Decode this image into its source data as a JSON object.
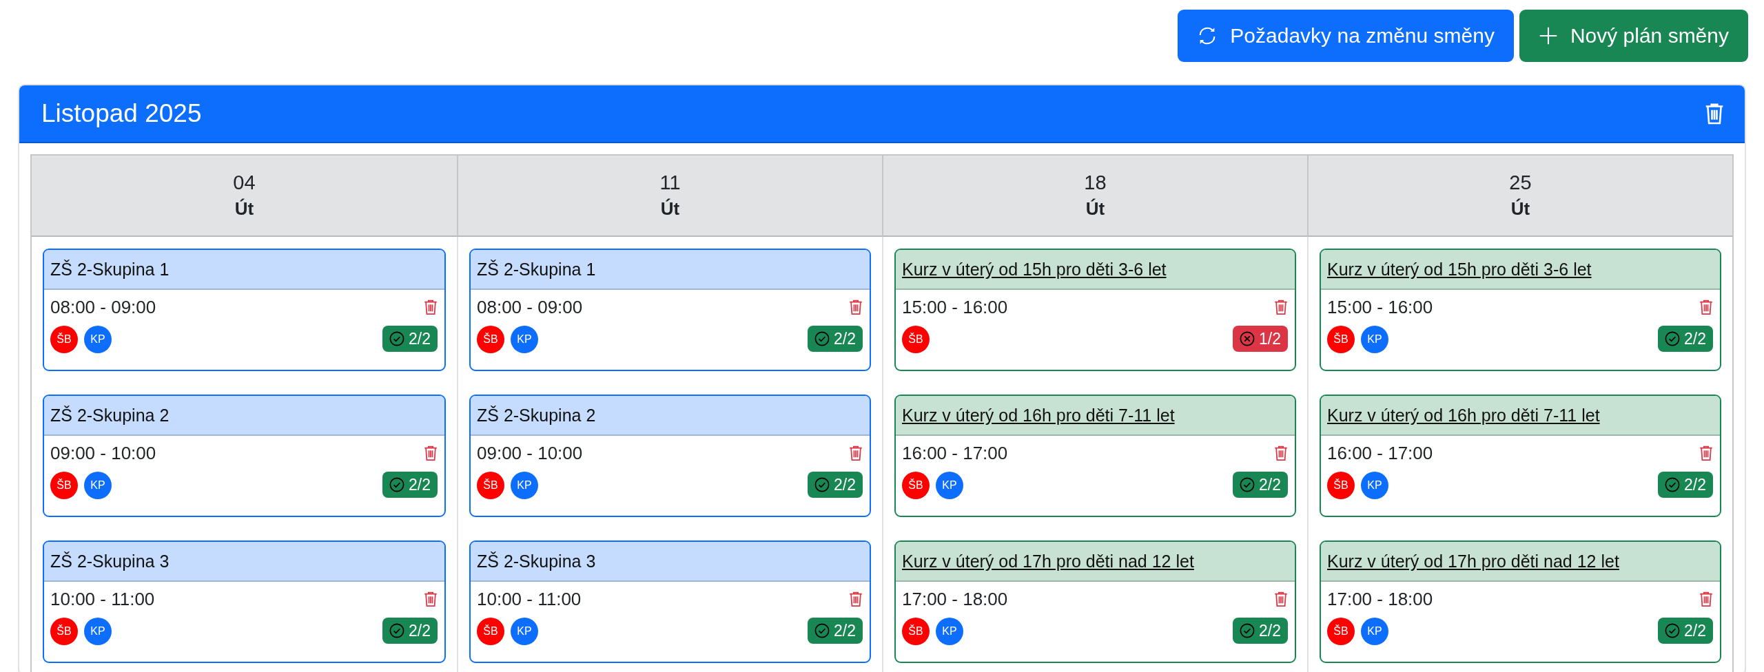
{
  "toolbar": {
    "buttons": [
      {
        "label": "Požadavky na změnu směny",
        "kind": "requests"
      },
      {
        "label": "Nový plán směny",
        "kind": "new"
      }
    ]
  },
  "panel": {
    "title": "Listopad 2025",
    "days": [
      {
        "date": "04",
        "weekday": "Út",
        "shifts": [
          {
            "kind": "group",
            "title": "ZŠ 2-Skupina 1",
            "time": "08:00 - 09:00",
            "people": [
              {
                "initials": "ŠB",
                "color": "#ff0000"
              },
              {
                "initials": "KP",
                "color": "#0d6efd"
              }
            ],
            "filled": true,
            "count": "2/2"
          },
          {
            "kind": "group",
            "title": "ZŠ 2-Skupina 2",
            "time": "09:00 - 10:00",
            "people": [
              {
                "initials": "ŠB",
                "color": "#ff0000"
              },
              {
                "initials": "KP",
                "color": "#0d6efd"
              }
            ],
            "filled": true,
            "count": "2/2"
          },
          {
            "kind": "group",
            "title": "ZŠ 2-Skupina 3",
            "time": "10:00 - 11:00",
            "people": [
              {
                "initials": "ŠB",
                "color": "#ff0000"
              },
              {
                "initials": "KP",
                "color": "#0d6efd"
              }
            ],
            "filled": true,
            "count": "2/2"
          }
        ]
      },
      {
        "date": "11",
        "weekday": "Út",
        "shifts": [
          {
            "kind": "group",
            "title": "ZŠ 2-Skupina 1",
            "time": "08:00 - 09:00",
            "people": [
              {
                "initials": "ŠB",
                "color": "#ff0000"
              },
              {
                "initials": "KP",
                "color": "#0d6efd"
              }
            ],
            "filled": true,
            "count": "2/2"
          },
          {
            "kind": "group",
            "title": "ZŠ 2-Skupina 2",
            "time": "09:00 - 10:00",
            "people": [
              {
                "initials": "ŠB",
                "color": "#ff0000"
              },
              {
                "initials": "KP",
                "color": "#0d6efd"
              }
            ],
            "filled": true,
            "count": "2/2"
          },
          {
            "kind": "group",
            "title": "ZŠ 2-Skupina 3",
            "time": "10:00 - 11:00",
            "people": [
              {
                "initials": "ŠB",
                "color": "#ff0000"
              },
              {
                "initials": "KP",
                "color": "#0d6efd"
              }
            ],
            "filled": true,
            "count": "2/2"
          }
        ]
      },
      {
        "date": "18",
        "weekday": "Út",
        "shifts": [
          {
            "kind": "course",
            "title": "Kurz v úterý od 15h pro děti 3-6 let",
            "time": "15:00 - 16:00",
            "people": [
              {
                "initials": "ŠB",
                "color": "#ff0000"
              }
            ],
            "filled": false,
            "count": "1/2"
          },
          {
            "kind": "course",
            "title": "Kurz v úterý od 16h pro děti 7-11 let",
            "time": "16:00 - 17:00",
            "people": [
              {
                "initials": "ŠB",
                "color": "#ff0000"
              },
              {
                "initials": "KP",
                "color": "#0d6efd"
              }
            ],
            "filled": true,
            "count": "2/2"
          },
          {
            "kind": "course",
            "title": "Kurz v úterý od 17h pro děti nad 12 let",
            "time": "17:00 - 18:00",
            "people": [
              {
                "initials": "ŠB",
                "color": "#ff0000"
              },
              {
                "initials": "KP",
                "color": "#0d6efd"
              }
            ],
            "filled": true,
            "count": "2/2"
          }
        ]
      },
      {
        "date": "25",
        "weekday": "Út",
        "shifts": [
          {
            "kind": "course",
            "title": "Kurz v úterý od 15h pro děti 3-6 let",
            "time": "15:00 - 16:00",
            "people": [
              {
                "initials": "ŠB",
                "color": "#ff0000"
              },
              {
                "initials": "KP",
                "color": "#0d6efd"
              }
            ],
            "filled": true,
            "count": "2/2"
          },
          {
            "kind": "course",
            "title": "Kurz v úterý od 16h pro děti 7-11 let",
            "time": "16:00 - 17:00",
            "people": [
              {
                "initials": "ŠB",
                "color": "#ff0000"
              },
              {
                "initials": "KP",
                "color": "#0d6efd"
              }
            ],
            "filled": true,
            "count": "2/2"
          },
          {
            "kind": "course",
            "title": "Kurz v úterý od 17h pro děti nad 12 let",
            "time": "17:00 - 18:00",
            "people": [
              {
                "initials": "ŠB",
                "color": "#ff0000"
              },
              {
                "initials": "KP",
                "color": "#0d6efd"
              }
            ],
            "filled": true,
            "count": "2/2"
          }
        ]
      }
    ]
  }
}
